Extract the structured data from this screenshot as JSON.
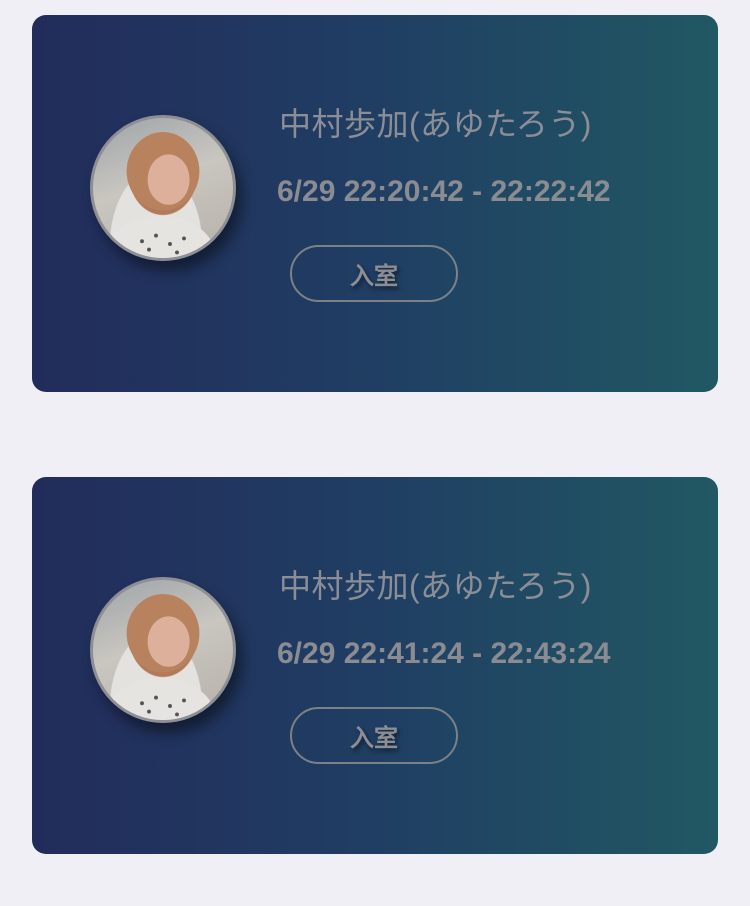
{
  "rooms": [
    {
      "name": "中村歩加(あゆたろう)",
      "time_range": "6/29 22:20:42 - 22:22:42",
      "enter_label": "入室"
    },
    {
      "name": "中村歩加(あゆたろう)",
      "time_range": "6/29 22:41:24 - 22:43:24",
      "enter_label": "入室"
    }
  ],
  "colors": {
    "background": "#f0eff5",
    "card_gradient_start": "#222c5b",
    "card_gradient_end": "#215863",
    "text": "#8b8e96"
  }
}
